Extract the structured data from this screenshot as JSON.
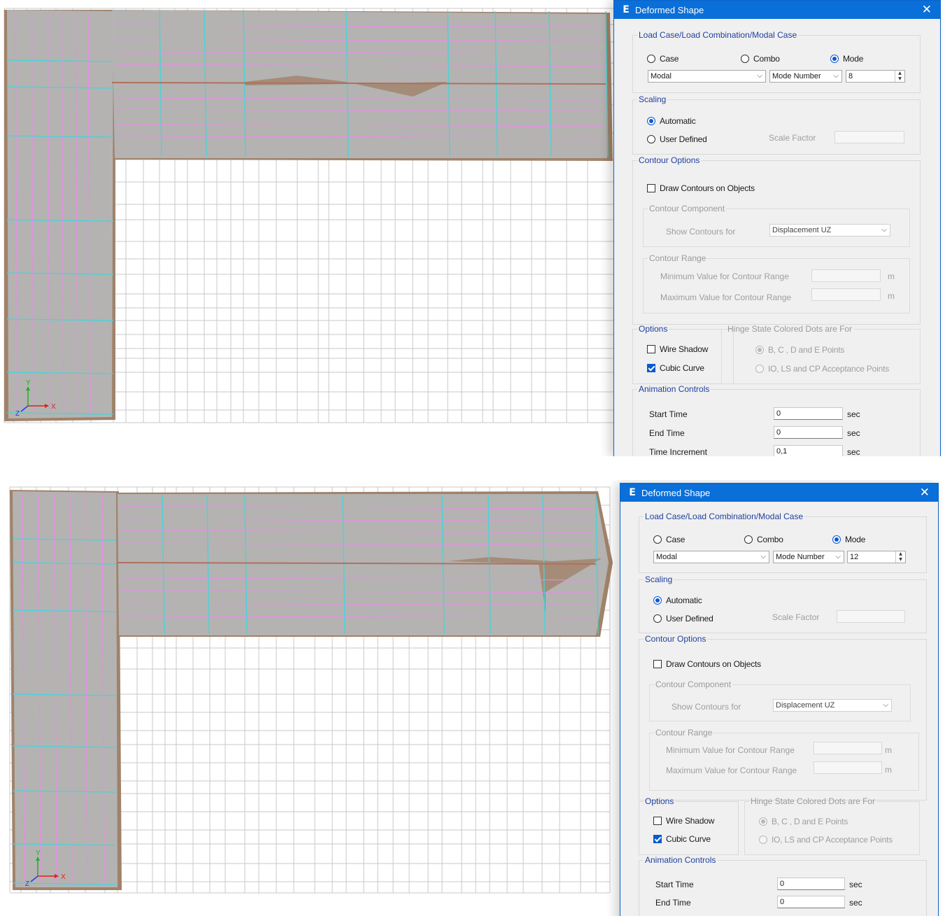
{
  "panels": [
    {
      "dialog": {
        "title": "Deformed Shape",
        "app_icon": "E",
        "load_case": {
          "legend": "Load Case/Load Combination/Modal Case",
          "radio_case": "Case",
          "radio_combo": "Combo",
          "radio_mode": "Mode",
          "selected_radio": "Mode",
          "modal_select": "Modal",
          "mode_select": "Mode Number",
          "mode_value": "8"
        },
        "scaling": {
          "legend": "Scaling",
          "automatic": "Automatic",
          "user_defined": "User Defined",
          "selected": "Automatic",
          "scale_factor_label": "Scale Factor",
          "scale_factor_value": ""
        },
        "contour": {
          "legend": "Contour Options",
          "draw_contours": "Draw Contours on Objects",
          "draw_contours_checked": false,
          "component_legend": "Contour Component",
          "show_for_label": "Show Contours for",
          "show_for_value": "Displacement UZ",
          "range_legend": "Contour Range",
          "min_label": "Minimum Value for Contour Range",
          "max_label": "Maximum Value for Contour Range",
          "unit": "m"
        },
        "options": {
          "legend": "Options",
          "wire_shadow": "Wire Shadow",
          "wire_shadow_checked": false,
          "cubic_curve": "Cubic Curve",
          "cubic_curve_checked": true
        },
        "hinge": {
          "legend": "Hinge State Colored Dots are For",
          "opt1": "B, C , D and E Points",
          "opt2": "IO, LS and CP Acceptance Points",
          "selected": "opt1"
        },
        "animation": {
          "legend": "Animation Controls",
          "start_label": "Start Time",
          "start_value": "0",
          "end_label": "End Time",
          "end_value": "0",
          "increment_label": "Time Increment",
          "increment_value": "0,1",
          "unit": "sec"
        }
      },
      "axis": {
        "x": "X",
        "y": "Y",
        "z": "Z"
      }
    },
    {
      "dialog": {
        "title": "Deformed Shape",
        "app_icon": "E",
        "load_case": {
          "legend": "Load Case/Load Combination/Modal Case",
          "radio_case": "Case",
          "radio_combo": "Combo",
          "radio_mode": "Mode",
          "selected_radio": "Mode",
          "modal_select": "Modal",
          "mode_select": "Mode Number",
          "mode_value": "12"
        },
        "scaling": {
          "legend": "Scaling",
          "automatic": "Automatic",
          "user_defined": "User Defined",
          "selected": "Automatic",
          "scale_factor_label": "Scale Factor",
          "scale_factor_value": ""
        },
        "contour": {
          "legend": "Contour Options",
          "draw_contours": "Draw Contours on Objects",
          "draw_contours_checked": false,
          "component_legend": "Contour Component",
          "show_for_label": "Show Contours for",
          "show_for_value": "Displacement UZ",
          "range_legend": "Contour Range",
          "min_label": "Minimum Value for Contour Range",
          "max_label": "Maximum Value for Contour Range",
          "unit": "m"
        },
        "options": {
          "legend": "Options",
          "wire_shadow": "Wire Shadow",
          "wire_shadow_checked": false,
          "cubic_curve": "Cubic Curve",
          "cubic_curve_checked": true
        },
        "hinge": {
          "legend": "Hinge State Colored Dots are For",
          "opt1": "B, C , D and E Points",
          "opt2": "IO, LS and CP Acceptance Points",
          "selected": "opt1"
        },
        "animation": {
          "legend": "Animation Controls",
          "start_label": "Start Time",
          "start_value": "0",
          "end_label": "End Time",
          "end_value": "0",
          "unit": "sec"
        }
      },
      "axis": {
        "x": "X",
        "y": "Y",
        "z": "Z"
      }
    }
  ],
  "colors": {
    "shell": "#b5b5b5",
    "shell_edge": "#a0826a",
    "grid": "#c8c8c8",
    "pink": "#e68ce6",
    "cyan": "#43d4dc",
    "dialog_title": "#0a6fd8",
    "accent": "#0a5ad0"
  },
  "icons": {
    "close": "close-icon",
    "app": "app-logo-icon",
    "dropdown": "chevron-down-icon",
    "spinner": "spinner-arrows-icon"
  }
}
